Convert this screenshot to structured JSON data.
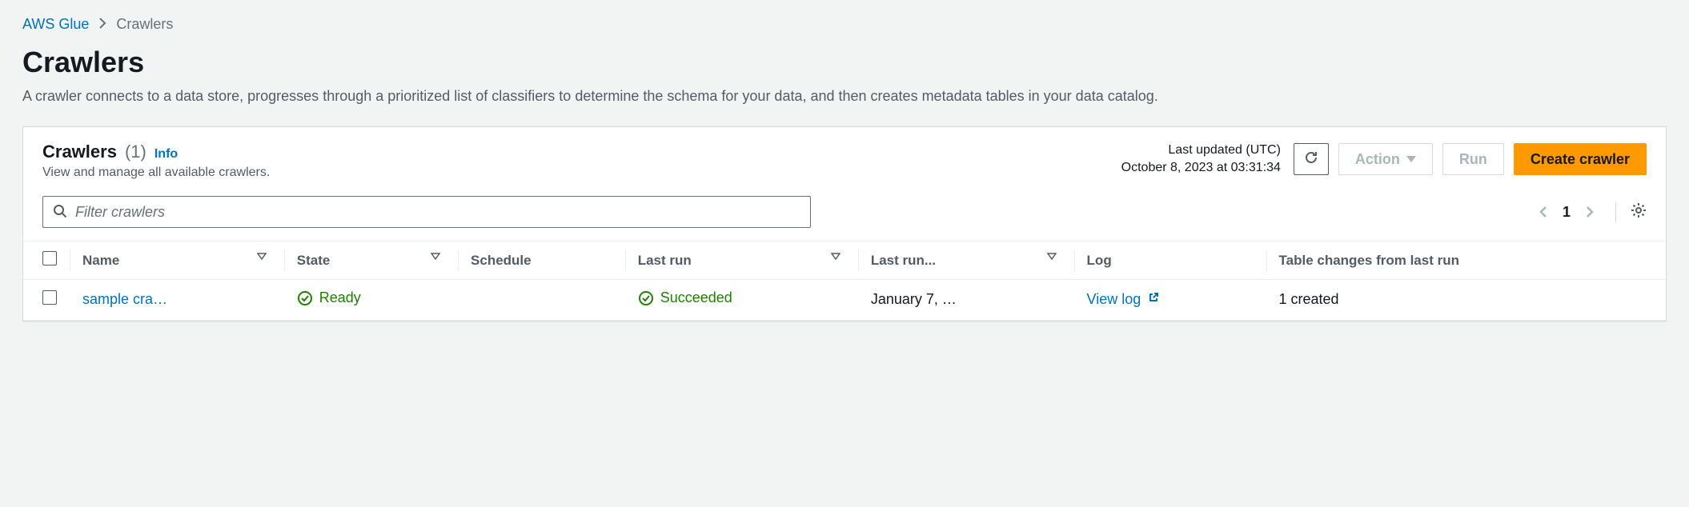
{
  "breadcrumb": {
    "root": "AWS Glue",
    "current": "Crawlers"
  },
  "page": {
    "title": "Crawlers",
    "description": "A crawler connects to a data store, progresses through a prioritized list of classifiers to determine the schema for your data, and then creates metadata tables in your data catalog."
  },
  "panel": {
    "title": "Crawlers",
    "count": "(1)",
    "info_label": "Info",
    "subtitle": "View and manage all available crawlers.",
    "last_updated_label": "Last updated (UTC)",
    "last_updated_value": "October 8, 2023 at 03:31:34",
    "buttons": {
      "action": "Action",
      "run": "Run",
      "create": "Create crawler"
    }
  },
  "search": {
    "placeholder": "Filter crawlers"
  },
  "pagination": {
    "page": "1"
  },
  "table": {
    "headers": {
      "name": "Name",
      "state": "State",
      "schedule": "Schedule",
      "last_run": "Last run",
      "last_run_dur": "Last run...",
      "log": "Log",
      "table_changes": "Table changes from last run"
    },
    "rows": [
      {
        "name": "sample cra…",
        "state": "Ready",
        "schedule": "",
        "last_run": "Succeeded",
        "last_run_dur": "January 7, …",
        "log": "View log",
        "table_changes": "1 created"
      }
    ]
  }
}
